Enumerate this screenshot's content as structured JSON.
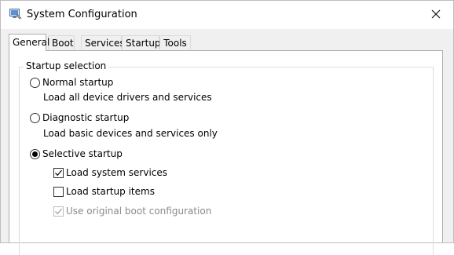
{
  "window": {
    "title": "System Configuration",
    "icon": "system-configuration-icon",
    "close_icon": "close-icon"
  },
  "tabs": [
    {
      "label": "General",
      "active": true
    },
    {
      "label": "Boot",
      "active": false
    },
    {
      "label": "Services",
      "active": false
    },
    {
      "label": "Startup",
      "active": false
    },
    {
      "label": "Tools",
      "active": false
    }
  ],
  "startup_selection": {
    "group_label": "Startup selection",
    "options": [
      {
        "label": "Normal startup",
        "description": "Load all device drivers and services",
        "selected": false
      },
      {
        "label": "Diagnostic startup",
        "description": "Load basic devices and services only",
        "selected": false
      },
      {
        "label": "Selective startup",
        "selected": true
      }
    ],
    "selective_options": [
      {
        "label": "Load system services",
        "checked": true,
        "enabled": true
      },
      {
        "label": "Load startup items",
        "checked": false,
        "enabled": true
      },
      {
        "label": "Use original boot configuration",
        "checked": true,
        "enabled": false
      }
    ]
  }
}
